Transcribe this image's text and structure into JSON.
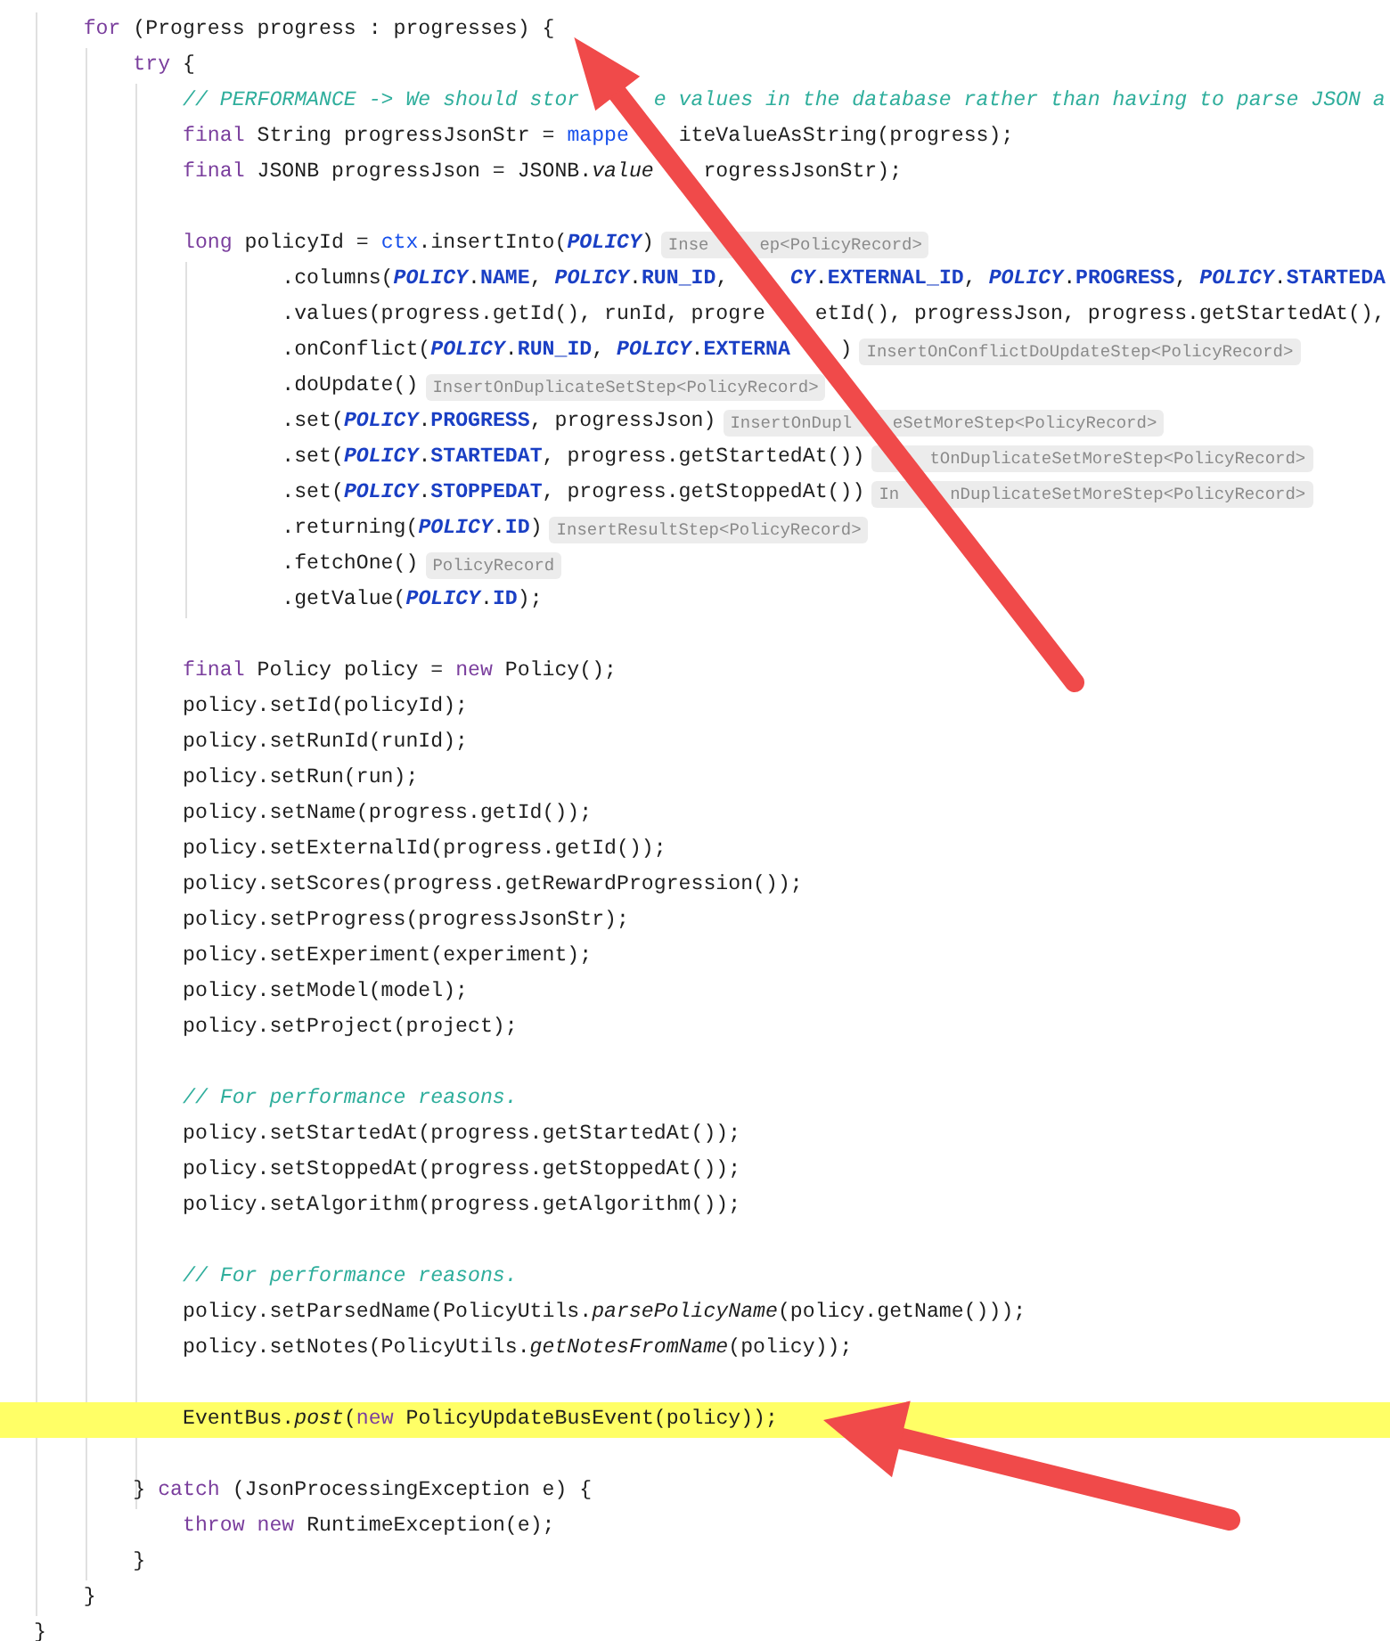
{
  "editor": {
    "lines": [
      {
        "highlighted": false,
        "tokens": [
          {
            "kind": "keyword",
            "text": "    for"
          },
          {
            "kind": "plain",
            "text": " (Progress progress : progresses) {"
          }
        ]
      },
      {
        "highlighted": false,
        "tokens": [
          {
            "kind": "keyword",
            "text": "        try"
          },
          {
            "kind": "plain",
            "text": " {"
          }
        ]
      },
      {
        "highlighted": false,
        "tokens": [
          {
            "kind": "comment",
            "text": "            // PERFORMANCE -> We should stor"
          },
          {
            "kind": "comment",
            "text": "      e values in the database rather than having to parse JSON a"
          }
        ]
      },
      {
        "highlighted": false,
        "tokens": [
          {
            "kind": "keyword",
            "text": "            final"
          },
          {
            "kind": "plain",
            "text": " String progressJsonStr = "
          },
          {
            "kind": "member",
            "text": "mappe"
          },
          {
            "kind": "plain",
            "text": "    iteValueAsString(progress);"
          }
        ]
      },
      {
        "highlighted": false,
        "tokens": [
          {
            "kind": "keyword",
            "text": "            final"
          },
          {
            "kind": "plain",
            "text": " JSONB progressJson = JSONB."
          },
          {
            "kind": "static",
            "text": "value"
          },
          {
            "kind": "plain",
            "text": "    rogressJsonStr);"
          }
        ]
      },
      {
        "highlighted": false
      },
      {
        "highlighted": false,
        "tokens": [
          {
            "kind": "keyword",
            "text": "            long"
          },
          {
            "kind": "plain",
            "text": " policyId = "
          },
          {
            "kind": "member",
            "text": "ctx"
          },
          {
            "kind": "plain",
            "text": ".insertInto("
          },
          {
            "kind": "constant",
            "text": "POLICY"
          },
          {
            "kind": "plain",
            "text": ")"
          },
          {
            "kind": "hint",
            "text": "Inse     ep<PolicyRecord>"
          }
        ]
      },
      {
        "highlighted": false,
        "tokens": [
          {
            "kind": "plain",
            "text": "                    .columns("
          },
          {
            "kind": "constant",
            "text": "POLICY"
          },
          {
            "kind": "plain",
            "text": "."
          },
          {
            "kind": "field",
            "text": "NAME"
          },
          {
            "kind": "plain",
            "text": ", "
          },
          {
            "kind": "constant",
            "text": "POLICY"
          },
          {
            "kind": "plain",
            "text": "."
          },
          {
            "kind": "field",
            "text": "RUN_ID"
          },
          {
            "kind": "plain",
            "text": ",     "
          },
          {
            "kind": "constant",
            "text": "CY"
          },
          {
            "kind": "plain",
            "text": "."
          },
          {
            "kind": "field",
            "text": "EXTERNAL_ID"
          },
          {
            "kind": "plain",
            "text": ", "
          },
          {
            "kind": "constant",
            "text": "POLICY"
          },
          {
            "kind": "plain",
            "text": "."
          },
          {
            "kind": "field",
            "text": "PROGRESS"
          },
          {
            "kind": "plain",
            "text": ", "
          },
          {
            "kind": "constant",
            "text": "POLICY"
          },
          {
            "kind": "plain",
            "text": "."
          },
          {
            "kind": "field",
            "text": "STARTEDA"
          }
        ]
      },
      {
        "highlighted": false,
        "tokens": [
          {
            "kind": "plain",
            "text": "                    .values(progress.getId(), runId, progre"
          },
          {
            "kind": "plain",
            "text": "    etId(), progressJson, progress.getStartedAt(),"
          }
        ]
      },
      {
        "highlighted": false,
        "tokens": [
          {
            "kind": "plain",
            "text": "                    .onConflict("
          },
          {
            "kind": "constant",
            "text": "POLICY"
          },
          {
            "kind": "plain",
            "text": "."
          },
          {
            "kind": "field",
            "text": "RUN_ID"
          },
          {
            "kind": "plain",
            "text": ", "
          },
          {
            "kind": "constant",
            "text": "POLICY"
          },
          {
            "kind": "plain",
            "text": "."
          },
          {
            "kind": "field",
            "text": "EXTERNA"
          },
          {
            "kind": "plain",
            "text": "    )"
          },
          {
            "kind": "hint",
            "text": "InsertOnConflictDoUpdateStep<PolicyRecord>"
          }
        ]
      },
      {
        "highlighted": false,
        "tokens": [
          {
            "kind": "plain",
            "text": "                    .doUpdate()"
          },
          {
            "kind": "hint",
            "text": "InsertOnDuplicateSetStep<PolicyRecord>"
          }
        ]
      },
      {
        "highlighted": false,
        "tokens": [
          {
            "kind": "plain",
            "text": "                    .set("
          },
          {
            "kind": "constant",
            "text": "POLICY"
          },
          {
            "kind": "plain",
            "text": "."
          },
          {
            "kind": "field",
            "text": "PROGRESS"
          },
          {
            "kind": "plain",
            "text": ", progressJson)"
          },
          {
            "kind": "hint",
            "text": "InsertOnDupl    eSetMoreStep<PolicyRecord>"
          }
        ]
      },
      {
        "highlighted": false,
        "tokens": [
          {
            "kind": "plain",
            "text": "                    .set("
          },
          {
            "kind": "constant",
            "text": "POLICY"
          },
          {
            "kind": "plain",
            "text": "."
          },
          {
            "kind": "field",
            "text": "STARTEDAT"
          },
          {
            "kind": "plain",
            "text": ", progress.getStartedAt())"
          },
          {
            "kind": "hint",
            "text": "     tOnDuplicateSetMoreStep<PolicyRecord>"
          }
        ]
      },
      {
        "highlighted": false,
        "tokens": [
          {
            "kind": "plain",
            "text": "                    .set("
          },
          {
            "kind": "constant",
            "text": "POLICY"
          },
          {
            "kind": "plain",
            "text": "."
          },
          {
            "kind": "field",
            "text": "STOPPEDAT"
          },
          {
            "kind": "plain",
            "text": ", progress.getStoppedAt())"
          },
          {
            "kind": "hint",
            "text": "In     nDuplicateSetMoreStep<PolicyRecord>"
          }
        ]
      },
      {
        "highlighted": false,
        "tokens": [
          {
            "kind": "plain",
            "text": "                    .returning("
          },
          {
            "kind": "constant",
            "text": "POLICY"
          },
          {
            "kind": "plain",
            "text": "."
          },
          {
            "kind": "field",
            "text": "ID"
          },
          {
            "kind": "plain",
            "text": ")"
          },
          {
            "kind": "hint",
            "text": "InsertResultStep<PolicyRecord>"
          }
        ]
      },
      {
        "highlighted": false,
        "tokens": [
          {
            "kind": "plain",
            "text": "                    .fetchOne()"
          },
          {
            "kind": "hint",
            "text": "PolicyRecord"
          }
        ]
      },
      {
        "highlighted": false,
        "tokens": [
          {
            "kind": "plain",
            "text": "                    .getValue("
          },
          {
            "kind": "constant",
            "text": "POLICY"
          },
          {
            "kind": "plain",
            "text": "."
          },
          {
            "kind": "field",
            "text": "ID"
          },
          {
            "kind": "plain",
            "text": ");"
          }
        ]
      },
      {
        "highlighted": false
      },
      {
        "highlighted": false,
        "tokens": [
          {
            "kind": "keyword",
            "text": "            final"
          },
          {
            "kind": "plain",
            "text": " Policy policy = "
          },
          {
            "kind": "keyword",
            "text": "new"
          },
          {
            "kind": "plain",
            "text": " Policy();"
          }
        ]
      },
      {
        "highlighted": false,
        "tokens": [
          {
            "kind": "plain",
            "text": "            policy.setId(policyId);"
          }
        ]
      },
      {
        "highlighted": false,
        "tokens": [
          {
            "kind": "plain",
            "text": "            policy.setRunId(runId);"
          }
        ]
      },
      {
        "highlighted": false,
        "tokens": [
          {
            "kind": "plain",
            "text": "            policy.setRun(run);"
          }
        ]
      },
      {
        "highlighted": false,
        "tokens": [
          {
            "kind": "plain",
            "text": "            policy.setName(progress.getId());"
          }
        ]
      },
      {
        "highlighted": false,
        "tokens": [
          {
            "kind": "plain",
            "text": "            policy.setExternalId(progress.getId());"
          }
        ]
      },
      {
        "highlighted": false,
        "tokens": [
          {
            "kind": "plain",
            "text": "            policy.setScores(progress.getRewardProgression());"
          }
        ]
      },
      {
        "highlighted": false,
        "tokens": [
          {
            "kind": "plain",
            "text": "            policy.setProgress(progressJsonStr);"
          }
        ]
      },
      {
        "highlighted": false,
        "tokens": [
          {
            "kind": "plain",
            "text": "            policy.setExperiment(experiment);"
          }
        ]
      },
      {
        "highlighted": false,
        "tokens": [
          {
            "kind": "plain",
            "text": "            policy.setModel(model);"
          }
        ]
      },
      {
        "highlighted": false,
        "tokens": [
          {
            "kind": "plain",
            "text": "            policy.setProject(project);"
          }
        ]
      },
      {
        "highlighted": false
      },
      {
        "highlighted": false,
        "tokens": [
          {
            "kind": "comment",
            "text": "            // For performance reasons."
          }
        ]
      },
      {
        "highlighted": false,
        "tokens": [
          {
            "kind": "plain",
            "text": "            policy.setStartedAt(progress.getStartedAt());"
          }
        ]
      },
      {
        "highlighted": false,
        "tokens": [
          {
            "kind": "plain",
            "text": "            policy.setStoppedAt(progress.getStoppedAt());"
          }
        ]
      },
      {
        "highlighted": false,
        "tokens": [
          {
            "kind": "plain",
            "text": "            policy.setAlgorithm(progress.getAlgorithm());"
          }
        ]
      },
      {
        "highlighted": false
      },
      {
        "highlighted": false,
        "tokens": [
          {
            "kind": "comment",
            "text": "            // For performance reasons."
          }
        ]
      },
      {
        "highlighted": false,
        "tokens": [
          {
            "kind": "plain",
            "text": "            policy.setParsedName(PolicyUtils."
          },
          {
            "kind": "static",
            "text": "parsePolicyName"
          },
          {
            "kind": "plain",
            "text": "(policy.getName()));"
          }
        ]
      },
      {
        "highlighted": false,
        "tokens": [
          {
            "kind": "plain",
            "text": "            policy.setNotes(PolicyUtils."
          },
          {
            "kind": "static",
            "text": "getNotesFromName"
          },
          {
            "kind": "plain",
            "text": "(policy));"
          }
        ]
      },
      {
        "highlighted": false
      },
      {
        "highlighted": true,
        "tokens": [
          {
            "kind": "plain",
            "text": "            EventBus."
          },
          {
            "kind": "static",
            "text": "post"
          },
          {
            "kind": "plain",
            "text": "("
          },
          {
            "kind": "keyword",
            "text": "new"
          },
          {
            "kind": "plain",
            "text": " PolicyUpdateBusEvent(policy));"
          }
        ]
      },
      {
        "highlighted": false
      },
      {
        "highlighted": false,
        "tokens": [
          {
            "kind": "plain",
            "text": "        } "
          },
          {
            "kind": "keyword",
            "text": "catch"
          },
          {
            "kind": "plain",
            "text": " (JsonProcessingException e) {"
          }
        ]
      },
      {
        "highlighted": false,
        "tokens": [
          {
            "kind": "keyword",
            "text": "            throw"
          },
          {
            "kind": "keyword",
            "text": " new"
          },
          {
            "kind": "plain",
            "text": " RuntimeException(e);"
          }
        ]
      },
      {
        "highlighted": false,
        "tokens": [
          {
            "kind": "plain",
            "text": "        }"
          }
        ]
      },
      {
        "highlighted": false,
        "tokens": [
          {
            "kind": "plain",
            "text": "    }"
          }
        ]
      },
      {
        "highlighted": false,
        "tokens": [
          {
            "kind": "plain",
            "text": "}"
          }
        ]
      }
    ]
  }
}
